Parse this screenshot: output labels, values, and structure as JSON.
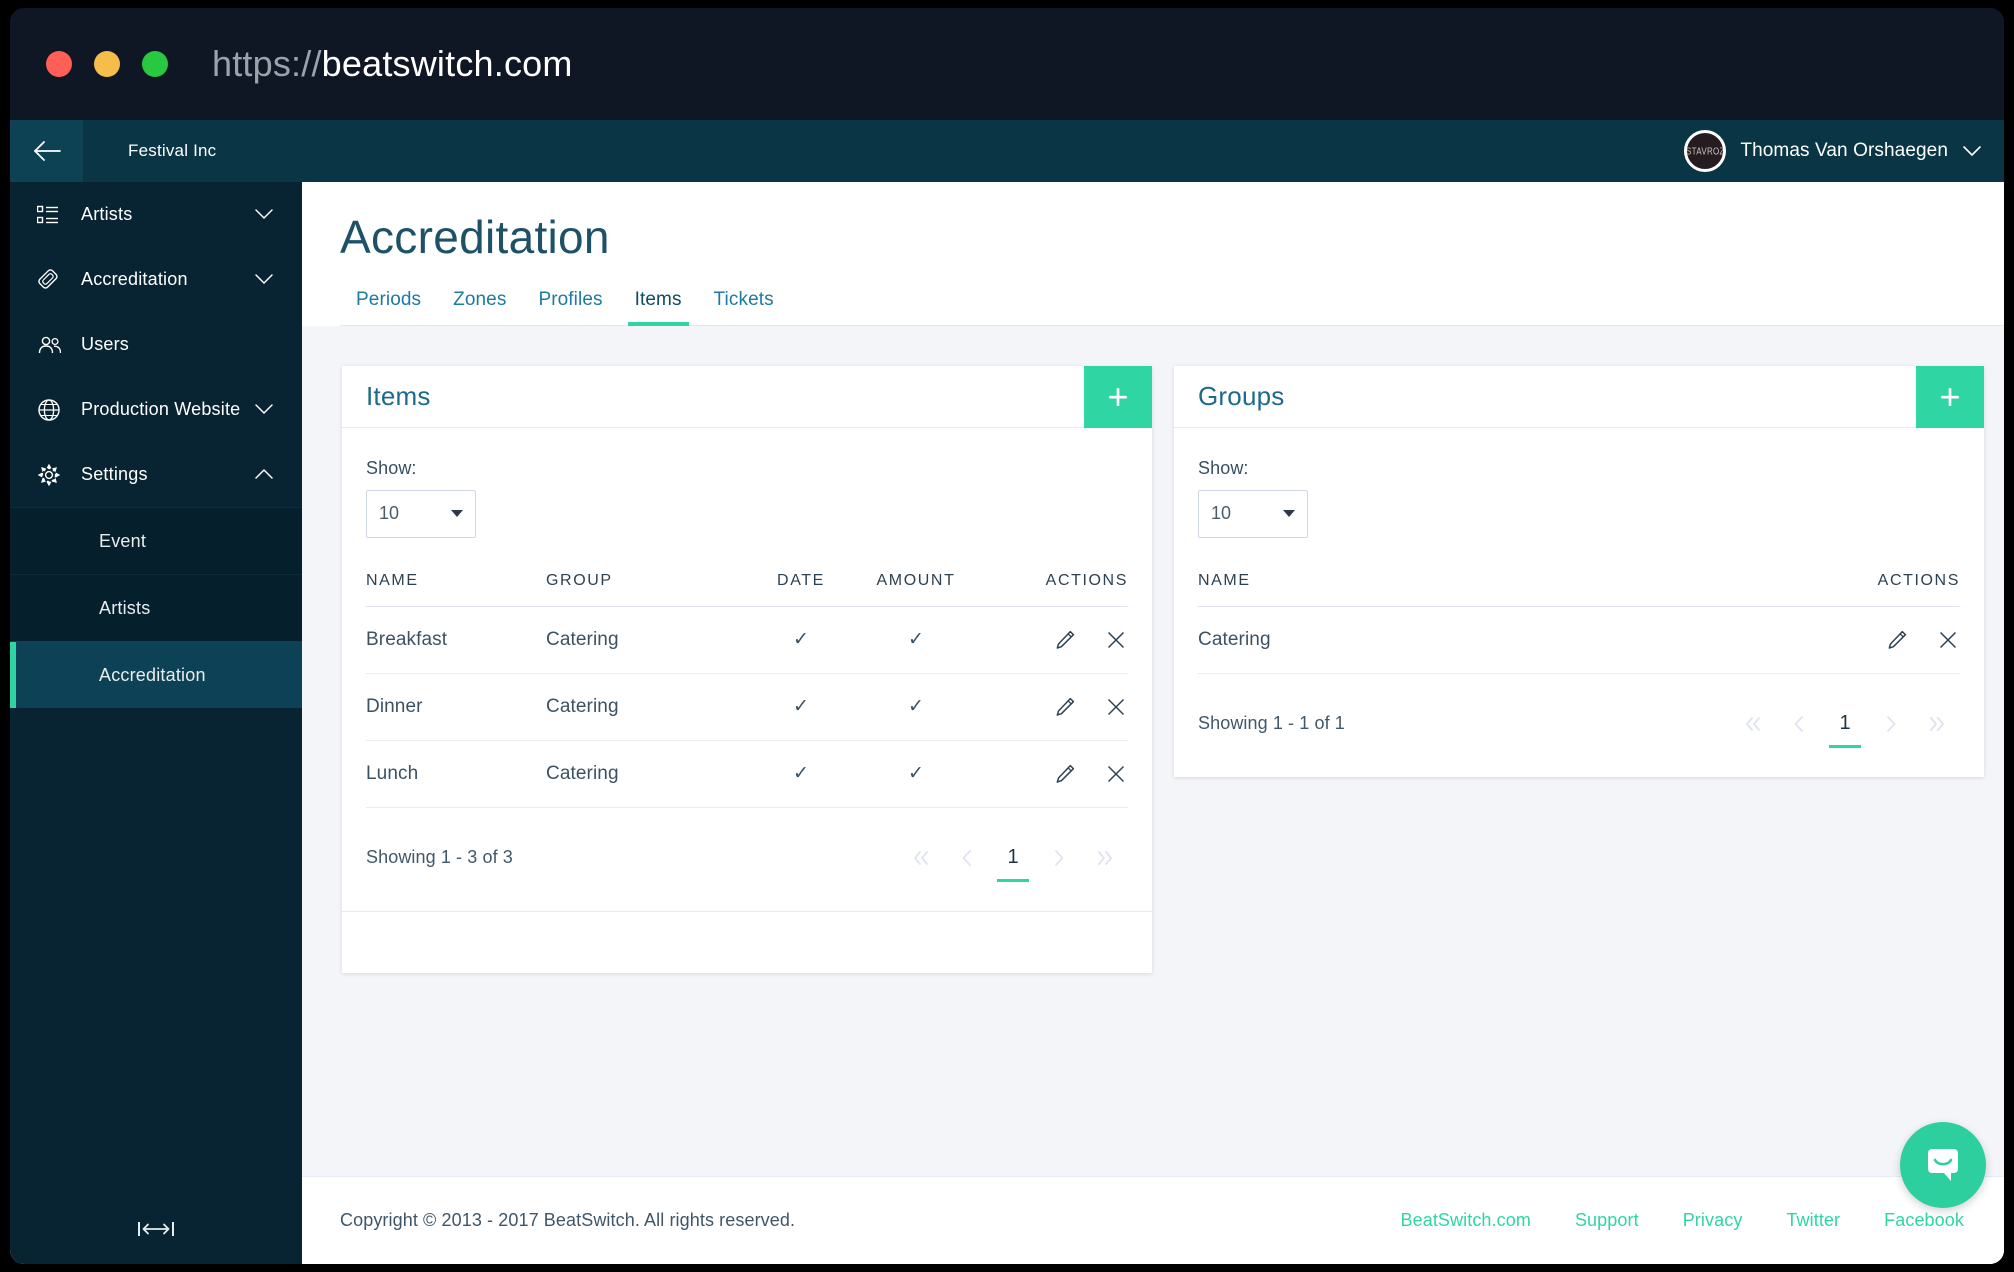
{
  "browser": {
    "url_scheme": "https://",
    "url_host": "beatswitch.com",
    "traffic_lights": [
      "close-red",
      "minimize-yellow",
      "maximize-green"
    ]
  },
  "topbar": {
    "back_icon": "arrow-left-icon",
    "event_name": "Festival Inc",
    "avatar_label": "STAVROZ",
    "user_name": "Thomas Van Orshaegen",
    "caret_icon": "chevron-down-icon"
  },
  "sidebar": {
    "items": [
      {
        "label": "Artists",
        "icon": "list-icon",
        "caret": "chevron-down-icon",
        "expanded": false
      },
      {
        "label": "Accreditation",
        "icon": "badge-icon",
        "caret": "chevron-down-icon",
        "expanded": false
      },
      {
        "label": "Users",
        "icon": "users-icon",
        "caret": "",
        "expanded": false
      },
      {
        "label": "Production Website",
        "icon": "globe-icon",
        "caret": "chevron-down-icon",
        "expanded": false
      },
      {
        "label": "Settings",
        "icon": "gear-icon",
        "caret": "chevron-up-icon",
        "expanded": true
      }
    ],
    "sub_items": [
      {
        "label": "Event",
        "active": false
      },
      {
        "label": "Artists",
        "active": false
      },
      {
        "label": "Accreditation",
        "active": true
      }
    ],
    "collapse_icon": "collapse-sidebar-icon"
  },
  "page": {
    "title": "Accreditation",
    "tabs": [
      {
        "label": "Periods",
        "active": false
      },
      {
        "label": "Zones",
        "active": false
      },
      {
        "label": "Profiles",
        "active": false
      },
      {
        "label": "Items",
        "active": true
      },
      {
        "label": "Tickets",
        "active": false
      }
    ]
  },
  "items_panel": {
    "title": "Items",
    "add_label": "+",
    "show_label": "Show:",
    "show_value": "10",
    "columns": [
      "NAME",
      "GROUP",
      "DATE",
      "AMOUNT",
      "ACTIONS"
    ],
    "rows": [
      {
        "name": "Breakfast",
        "group": "Catering",
        "date": "✓",
        "amount": "✓"
      },
      {
        "name": "Dinner",
        "group": "Catering",
        "date": "✓",
        "amount": "✓"
      },
      {
        "name": "Lunch",
        "group": "Catering",
        "date": "✓",
        "amount": "✓"
      }
    ],
    "showing_text": "Showing 1 - 3 of 3",
    "pagination": {
      "first": "«",
      "prev": "‹",
      "current_page": "1",
      "next": "›",
      "last": "»"
    }
  },
  "groups_panel": {
    "title": "Groups",
    "add_label": "+",
    "show_label": "Show:",
    "show_value": "10",
    "columns": [
      "NAME",
      "ACTIONS"
    ],
    "rows": [
      {
        "name": "Catering"
      }
    ],
    "showing_text": "Showing 1 - 1 of 1",
    "pagination": {
      "first": "«",
      "prev": "‹",
      "current_page": "1",
      "next": "›",
      "last": "»"
    }
  },
  "footer": {
    "copyright": "Copyright © 2013 - 2017 BeatSwitch. All rights reserved.",
    "links": [
      {
        "label": "BeatSwitch.com"
      },
      {
        "label": "Support"
      },
      {
        "label": "Privacy"
      },
      {
        "label": "Twitter"
      },
      {
        "label": "Facebook"
      }
    ]
  },
  "chat": {
    "icon": "intercom-chat-icon"
  },
  "colors": {
    "accent_green": "#2fd6a3",
    "sidebar_bg": "#082432",
    "topbar_bg": "#0a3545",
    "title_blue": "#1d5168",
    "tab_blue": "#1d7ba0",
    "page_bg": "#f4f5f9"
  }
}
